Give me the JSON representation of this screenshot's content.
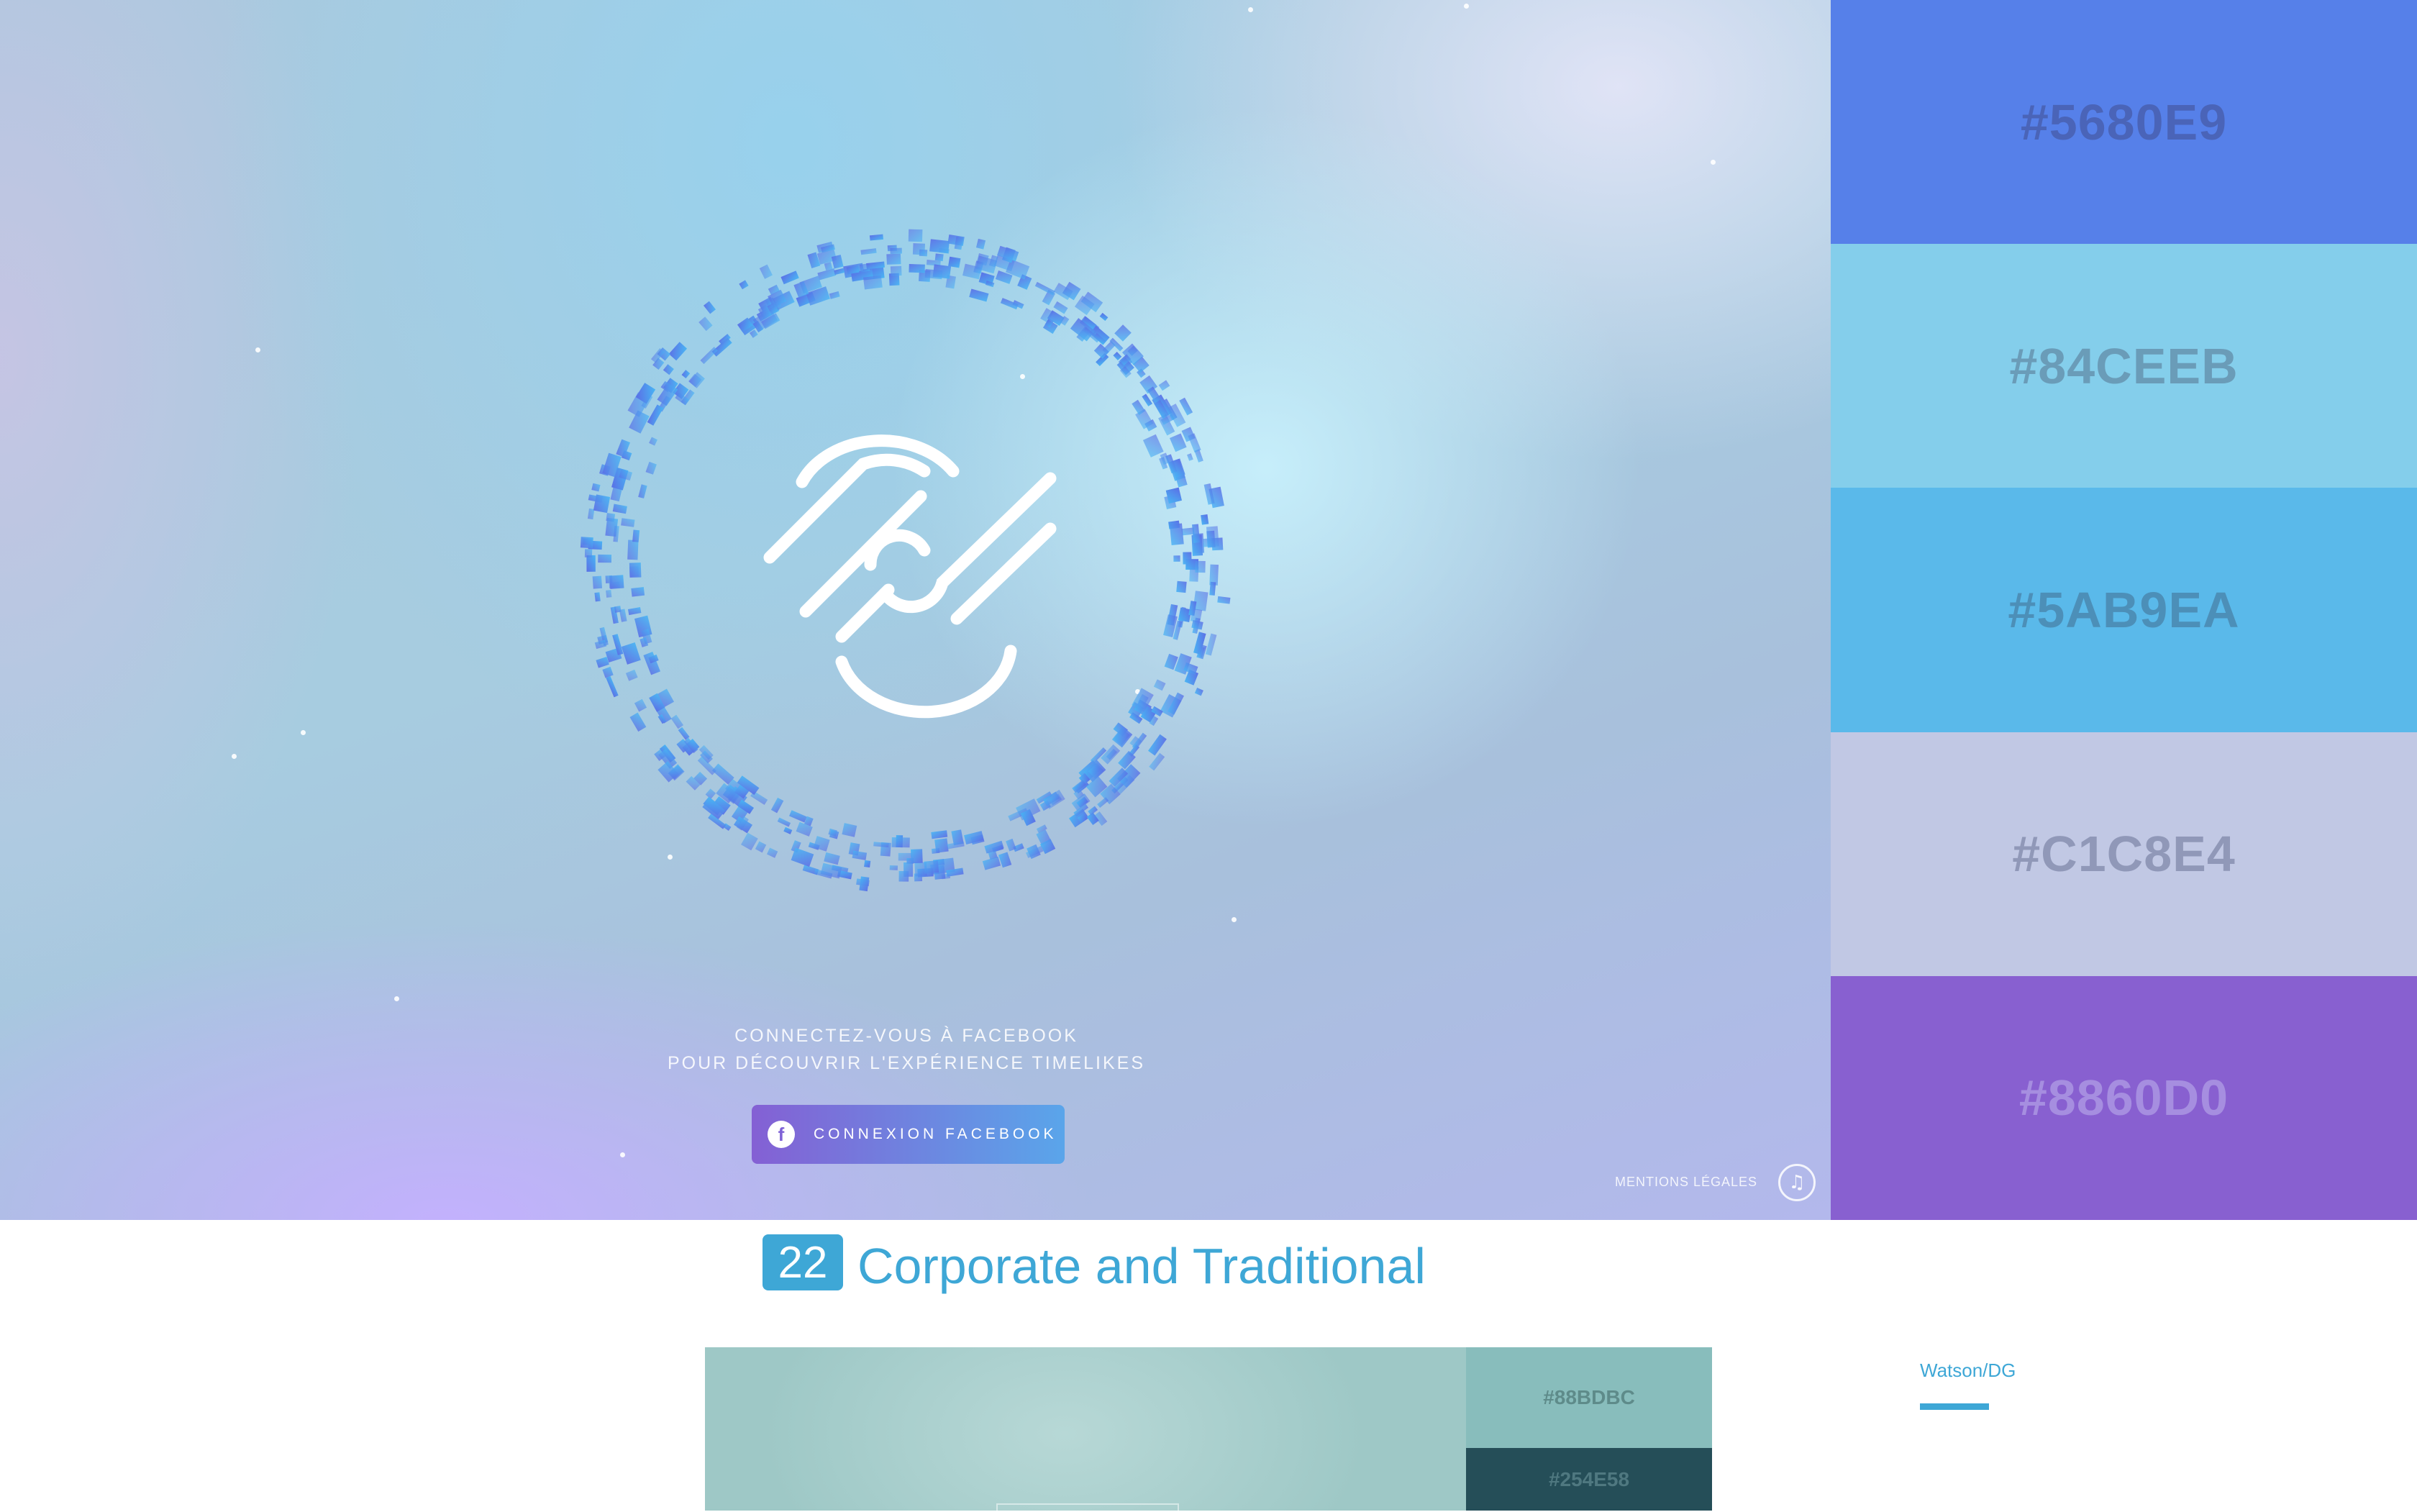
{
  "hero": {
    "line1": "CONNECTEZ-VOUS À FACEBOOK",
    "line2": "POUR DÉCOUVRIR L'EXPÉRIENCE TIMELIKES",
    "button_icon": "f",
    "button_label": "CONNEXION FACEBOOK",
    "legal": "MENTIONS LÉGALES",
    "music_icon": "♫"
  },
  "icons": {
    "logo": "timelikes-logo-icon",
    "facebook": "facebook-icon",
    "music": "music-note-icon"
  },
  "palette": [
    {
      "hex": "#5680E9",
      "color": "#5680e9",
      "text_color": "#4a64b8"
    },
    {
      "hex": "#84CEEB",
      "color": "#84ceeb",
      "text_color": "#6a9cb8"
    },
    {
      "hex": "#5AB9EA",
      "color": "#5ab9ea",
      "text_color": "#4c8fb8"
    },
    {
      "hex": "#C1C8E4",
      "color": "#c1c8e4",
      "text_color": "#9098b8"
    },
    {
      "hex": "#8860D0",
      "color": "#8860d0",
      "text_color": "#a68ee0"
    }
  ],
  "section": {
    "number": "22",
    "title": "Corporate and Traditional"
  },
  "next_preview": {
    "swatch1": "#88BDBC",
    "swatch2": "#254E58"
  },
  "credit": {
    "label": "Watson/DG"
  },
  "colors": {
    "accent": "#3ea7d6",
    "ring_start": "#5a72e4",
    "ring_end": "#4fb0f0"
  }
}
